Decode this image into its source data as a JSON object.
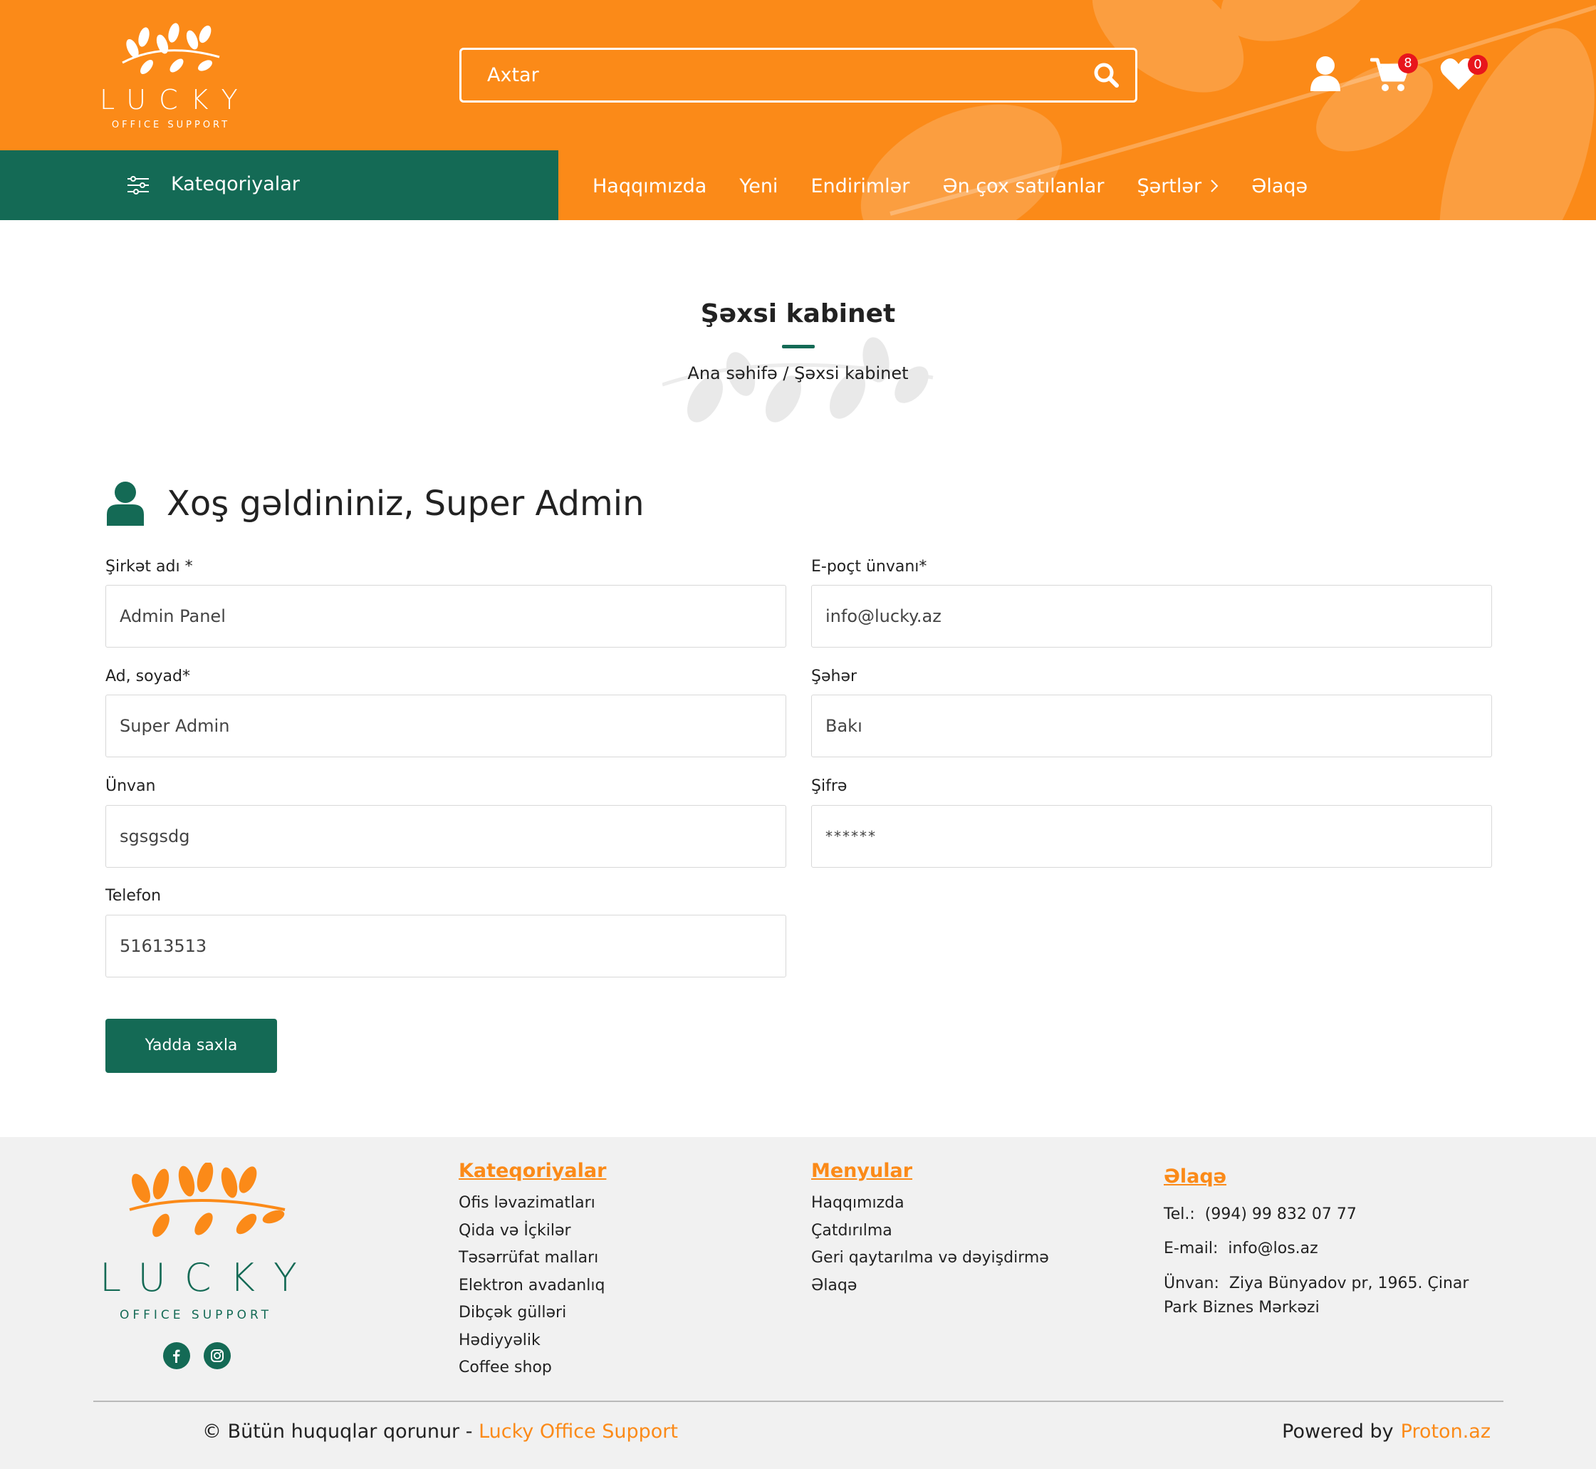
{
  "header": {
    "logo_word": "LUCKY",
    "logo_sub": "OFFICE SUPPORT",
    "search_placeholder": "Axtar",
    "cart_count": "8",
    "wishlist_count": "0",
    "categories_label": "Kateqoriyalar",
    "nav": [
      "Haqqımızda",
      "Yeni",
      "Endirimlər",
      "Ən çox satılanlar",
      "Şərtlər",
      "Əlaqə"
    ]
  },
  "page": {
    "title": "Şəxsi kabinet",
    "breadcrumb": "Ana səhifə / Şəxsi kabinet",
    "welcome": "Xoş gəldininiz,",
    "user_name": "Super Admin"
  },
  "form": {
    "company_label": "Şirkət adı *",
    "company_value": "Admin Panel",
    "email_label": "E-poçt ünvanı*",
    "email_value": "info@lucky.az",
    "name_label": "Ad, soyad*",
    "name_value": "Super Admin",
    "city_label": "Şəhər",
    "city_value": "Bakı",
    "address_label": "Ünvan",
    "address_value": "sgsgsdg",
    "password_label": "Şifrə",
    "password_value": "******",
    "phone_label": "Telefon",
    "phone_value": "51613513",
    "save_label": "Yadda saxla"
  },
  "footer": {
    "logo_word": "LUCKY",
    "logo_sub": "OFFICE SUPPORT",
    "categories_title": "Kateqoriyalar",
    "categories": [
      "Ofis ləvazimatları",
      "Qida və İçkilər",
      "Təsərrüfat malları",
      "Elektron avadanlıq",
      "Dibçək gülləri",
      "Hədiyyəlik",
      "Coffee shop"
    ],
    "menus_title": "Menyular",
    "menus": [
      "Haqqımızda",
      "Çatdırılma",
      "Geri qaytarılma və dəyişdirmə",
      "Əlaqə"
    ],
    "contact_title": "Əlaqə",
    "tel_key": "Tel.:",
    "tel_value": "(994) 99 832 07 77",
    "email_key": "E-mail:",
    "email_value": "info@los.az",
    "address_key": "Ünvan:",
    "address_value_1": "Ziya Bünyadov pr, 1965. Çinar",
    "address_value_2": "Park Biznes Mərkəzi",
    "copyright_text": "© Bütün huquqlar qorunur - ",
    "copyright_brand": "Lucky Office Support",
    "powered_text": "Powered by",
    "powered_brand": "Proton.az"
  },
  "colors": {
    "brand_orange": "#fb8a18",
    "brand_green": "#146a55",
    "badge_red": "#e8151c",
    "footer_bg": "#f1f1f1"
  },
  "icons": [
    "search-icon",
    "user-icon",
    "cart-icon",
    "heart-icon",
    "menu-sliders-icon",
    "chevron-right-icon",
    "facebook-icon",
    "instagram-icon"
  ]
}
